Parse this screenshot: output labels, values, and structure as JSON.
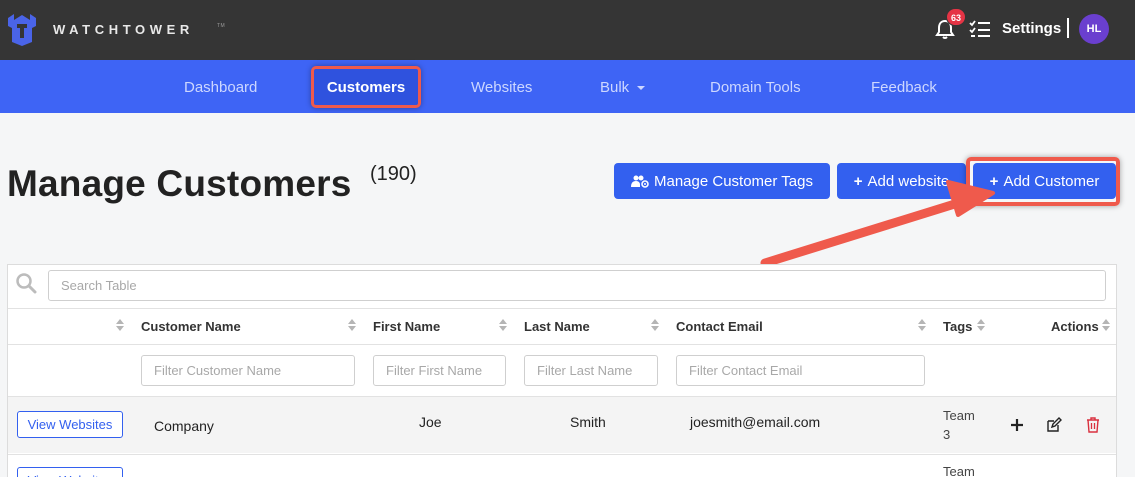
{
  "app": {
    "brand": "WATCHTOWER",
    "brand_tm": "TM"
  },
  "topbar": {
    "notification_count": "63",
    "settings_label": "Settings",
    "avatar_initials": "HL"
  },
  "nav": {
    "items": [
      "Dashboard",
      "Customers",
      "Websites",
      "Bulk",
      "Domain Tools",
      "Feedback"
    ],
    "active": "Customers"
  },
  "page": {
    "title": "Manage Customers",
    "count": "(190)"
  },
  "buttons": {
    "manage_tags": "Manage Customer Tags",
    "add_website": "Add website",
    "add_customer": "Add Customer"
  },
  "table": {
    "search_placeholder": "Search Table",
    "columns": [
      "Customer Name",
      "First Name",
      "Last Name",
      "Contact Email",
      "Tags",
      "Actions"
    ],
    "filters": [
      "Filter Customer Name",
      "Filter First Name",
      "Filter Last Name",
      "Filter Contact Email"
    ],
    "view_label": "View Websites",
    "rows": [
      {
        "customer": "Company",
        "first": "Joe",
        "last": "Smith",
        "email": "joesmith@email.com",
        "tags": "Team 3"
      },
      {
        "tags": "Team"
      }
    ]
  },
  "colors": {
    "topbar": "#353535",
    "nav": "#3e64f5",
    "button": "#3360ef",
    "highlight": "#ef5a4c",
    "avatar": "#6a3fcf",
    "badge": "#e53445",
    "delete": "#d9303e"
  }
}
